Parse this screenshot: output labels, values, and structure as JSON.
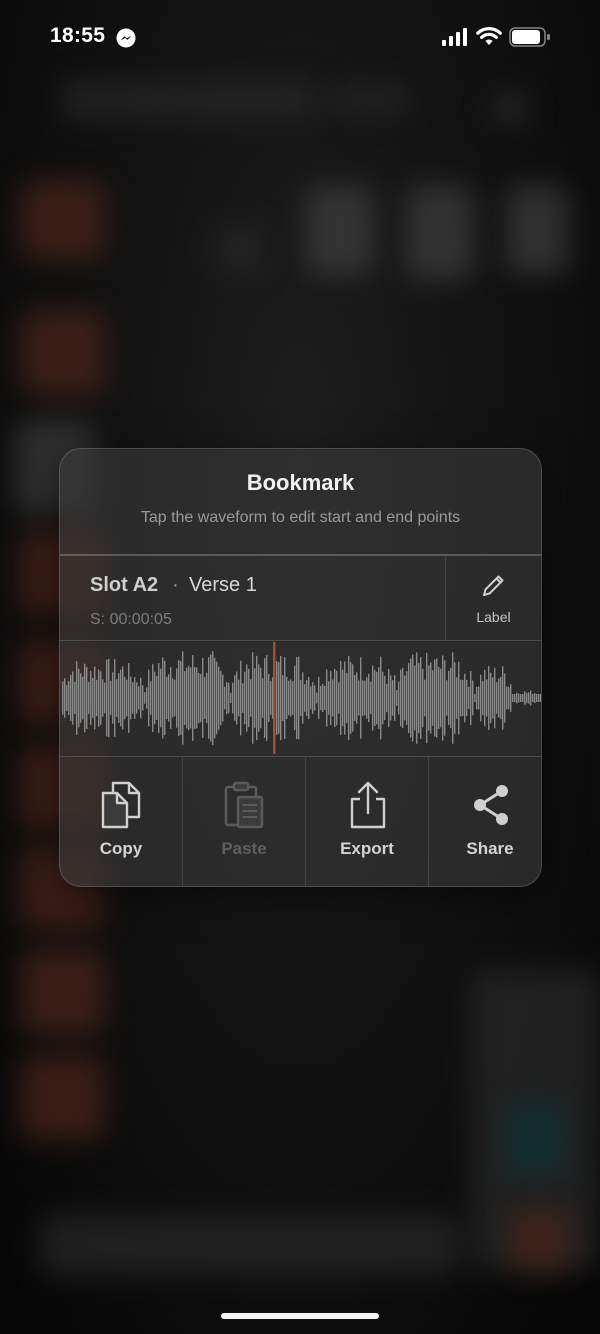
{
  "status_bar": {
    "time": "18:55",
    "icons": [
      "messenger-icon",
      "signal-icon",
      "wifi-icon",
      "battery-icon"
    ]
  },
  "bookmark": {
    "title": "Bookmark",
    "subtitle": "Tap the waveform to edit start and end points",
    "slot": "Slot A2",
    "separator": "·",
    "name": "Verse 1",
    "start_time": "S: 00:00:05",
    "label_button": "Label",
    "playhead_color": "#a0522d",
    "actions": [
      {
        "label": "Copy",
        "icon": "copy-icon",
        "enabled": true
      },
      {
        "label": "Paste",
        "icon": "paste-icon",
        "enabled": false
      },
      {
        "label": "Export",
        "icon": "export-icon",
        "enabled": true
      },
      {
        "label": "Share",
        "icon": "share-icon",
        "enabled": true
      }
    ]
  },
  "colors": {
    "waveform": "#8a8a8a",
    "playhead": "#a0522d",
    "card_background": "#3a3a3a"
  }
}
